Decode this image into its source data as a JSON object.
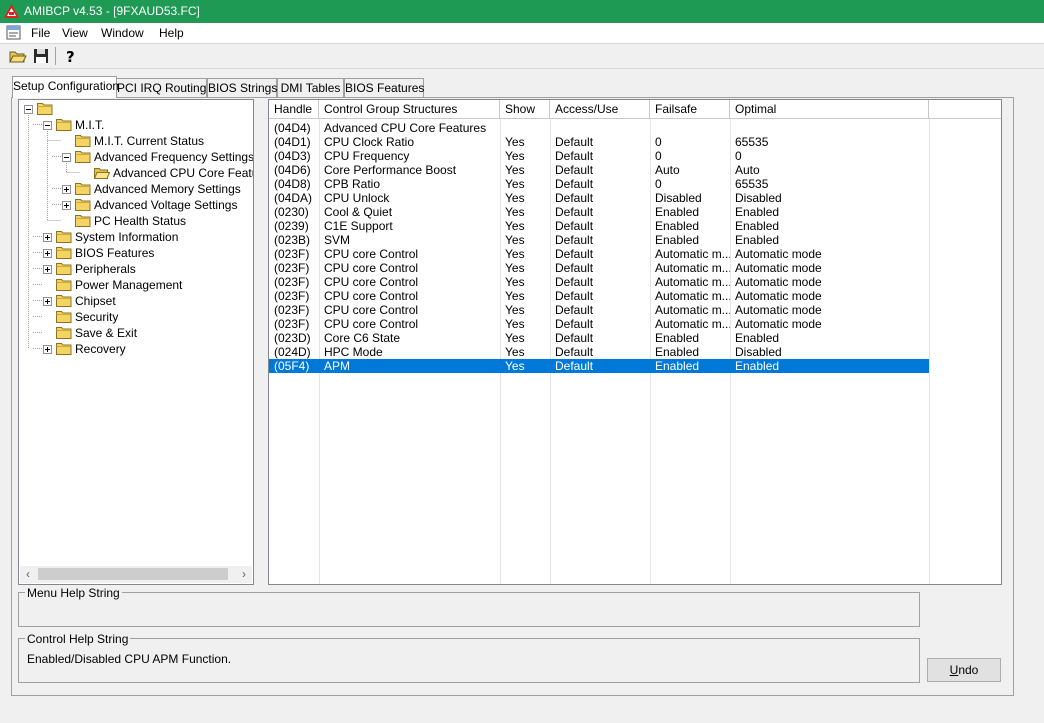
{
  "window": {
    "title": "AMIBCP v4.53 - [9FXAUD53.FC]",
    "titlebar_color": "#1f9a55"
  },
  "menubar": {
    "items": [
      "File",
      "View",
      "Window",
      "Help"
    ]
  },
  "toolbar": {
    "buttons": [
      "open-folder-icon",
      "save-disk-icon",
      "help-question-icon"
    ]
  },
  "tabs": [
    "Setup Configuration",
    "PCI IRQ Routing",
    "BIOS Strings",
    "DMI Tables",
    "BIOS Features"
  ],
  "active_tab": "Setup Configuration",
  "tree": {
    "nodes": [
      {
        "label": "",
        "depth": 0,
        "expander": "minus"
      },
      {
        "label": "M.I.T.",
        "depth": 1,
        "expander": "minus"
      },
      {
        "label": "M.I.T. Current Status",
        "depth": 2,
        "expander": "none"
      },
      {
        "label": "Advanced Frequency Settings",
        "depth": 2,
        "expander": "minus"
      },
      {
        "label": "Advanced CPU Core Features",
        "depth": 3,
        "expander": "none",
        "open": true
      },
      {
        "label": "Advanced Memory Settings",
        "depth": 2,
        "expander": "plus"
      },
      {
        "label": "Advanced Voltage Settings",
        "depth": 2,
        "expander": "plus"
      },
      {
        "label": "PC Health Status",
        "depth": 2,
        "expander": "none"
      },
      {
        "label": "System Information",
        "depth": 1,
        "expander": "plus"
      },
      {
        "label": "BIOS Features",
        "depth": 1,
        "expander": "plus"
      },
      {
        "label": "Peripherals",
        "depth": 1,
        "expander": "plus"
      },
      {
        "label": "Power Management",
        "depth": 1,
        "expander": "none"
      },
      {
        "label": "Chipset",
        "depth": 1,
        "expander": "plus"
      },
      {
        "label": "Security",
        "depth": 1,
        "expander": "none"
      },
      {
        "label": "Save & Exit",
        "depth": 1,
        "expander": "none"
      },
      {
        "label": "Recovery",
        "depth": 1,
        "expander": "plus"
      }
    ]
  },
  "grid": {
    "columns": [
      "Handle",
      "Control Group Structures",
      "Show",
      "Access/Use",
      "Failsafe",
      "Optimal"
    ],
    "rows": [
      [
        "(04D4)",
        "Advanced CPU Core Features",
        "",
        "",
        "",
        ""
      ],
      [
        "(04D1)",
        "CPU Clock Ratio",
        "Yes",
        "Default",
        "0",
        "65535"
      ],
      [
        "(04D3)",
        "CPU Frequency",
        "Yes",
        "Default",
        "0",
        "0"
      ],
      [
        "(04D6)",
        "Core Performance Boost",
        "Yes",
        "Default",
        "Auto",
        "Auto"
      ],
      [
        "(04D8)",
        "CPB Ratio",
        "Yes",
        "Default",
        "0",
        "65535"
      ],
      [
        "(04DA)",
        "CPU Unlock",
        "Yes",
        "Default",
        "Disabled",
        "Disabled"
      ],
      [
        "(0230)",
        "Cool & Quiet",
        "Yes",
        "Default",
        "Enabled",
        "Enabled"
      ],
      [
        "(0239)",
        "C1E Support",
        "Yes",
        "Default",
        "Enabled",
        "Enabled"
      ],
      [
        "(023B)",
        "SVM",
        "Yes",
        "Default",
        "Enabled",
        "Enabled"
      ],
      [
        "(023F)",
        "CPU core Control",
        "Yes",
        "Default",
        "Automatic m...",
        "Automatic mode"
      ],
      [
        "(023F)",
        "CPU core Control",
        "Yes",
        "Default",
        "Automatic m...",
        "Automatic mode"
      ],
      [
        "(023F)",
        "CPU core Control",
        "Yes",
        "Default",
        "Automatic m...",
        "Automatic mode"
      ],
      [
        "(023F)",
        "CPU core Control",
        "Yes",
        "Default",
        "Automatic m...",
        "Automatic mode"
      ],
      [
        "(023F)",
        "CPU core Control",
        "Yes",
        "Default",
        "Automatic m...",
        "Automatic mode"
      ],
      [
        "(023F)",
        "CPU core Control",
        "Yes",
        "Default",
        "Automatic m...",
        "Automatic mode"
      ],
      [
        "(023D)",
        "Core C6 State",
        "Yes",
        "Default",
        "Enabled",
        "Enabled"
      ],
      [
        "(024D)",
        "HPC Mode",
        "Yes",
        "Default",
        "Enabled",
        "Disabled"
      ],
      [
        "(05F4)",
        "APM",
        "Yes",
        "Default",
        "Enabled",
        "Enabled"
      ]
    ],
    "selected_row": 17,
    "selection_color": "#0078d7"
  },
  "menu_help": {
    "legend": "Menu Help String",
    "text": ""
  },
  "control_help": {
    "legend": "Control Help String",
    "text": "Enabled/Disabled CPU APM Function."
  },
  "undo_button": {
    "accel": "U",
    "rest": "ndo"
  }
}
